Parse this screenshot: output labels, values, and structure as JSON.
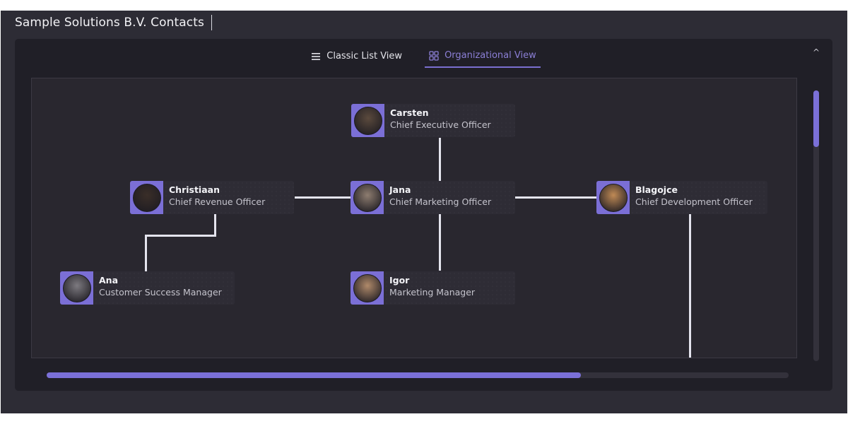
{
  "window": {
    "title": "Sample Solutions B.V. Contacts"
  },
  "tabs": [
    {
      "label": "Classic List View",
      "icon": "list-icon",
      "active": false
    },
    {
      "label": "Organizational View",
      "icon": "grid-icon",
      "active": true
    }
  ],
  "collapse_icon": "^",
  "colors": {
    "accent": "#7b70d8",
    "panel": "#201f27",
    "canvas": "#29272f",
    "connector": "#e4e4ee"
  },
  "org": {
    "people": [
      {
        "id": "carsten",
        "name": "Carsten",
        "role": "Chief Executive Officer",
        "avatar_bg": "#5b4a3d"
      },
      {
        "id": "christiaan",
        "name": "Christiaan",
        "role": "Chief Revenue Officer",
        "avatar_bg": "#3a2e28"
      },
      {
        "id": "jana",
        "name": "Jana",
        "role": "Chief Marketing Officer",
        "avatar_bg": "#8e7d70"
      },
      {
        "id": "blagojce",
        "name": "Blagojce",
        "role": "Chief Development Officer",
        "avatar_bg": "#c08a55"
      },
      {
        "id": "ana",
        "name": "Ana",
        "role": "Customer Success Manager",
        "avatar_bg": "#7d7a80"
      },
      {
        "id": "igor",
        "name": "Igor",
        "role": "Marketing Manager",
        "avatar_bg": "#b08a6a"
      }
    ],
    "reports_to": {
      "christiaan": "carsten",
      "jana": "carsten",
      "blagojce": "carsten",
      "ana": "christiaan",
      "igor": "jana"
    }
  },
  "scrollbars": {
    "horizontal_position_fraction": 0.72,
    "vertical_position_fraction": 0.21
  }
}
